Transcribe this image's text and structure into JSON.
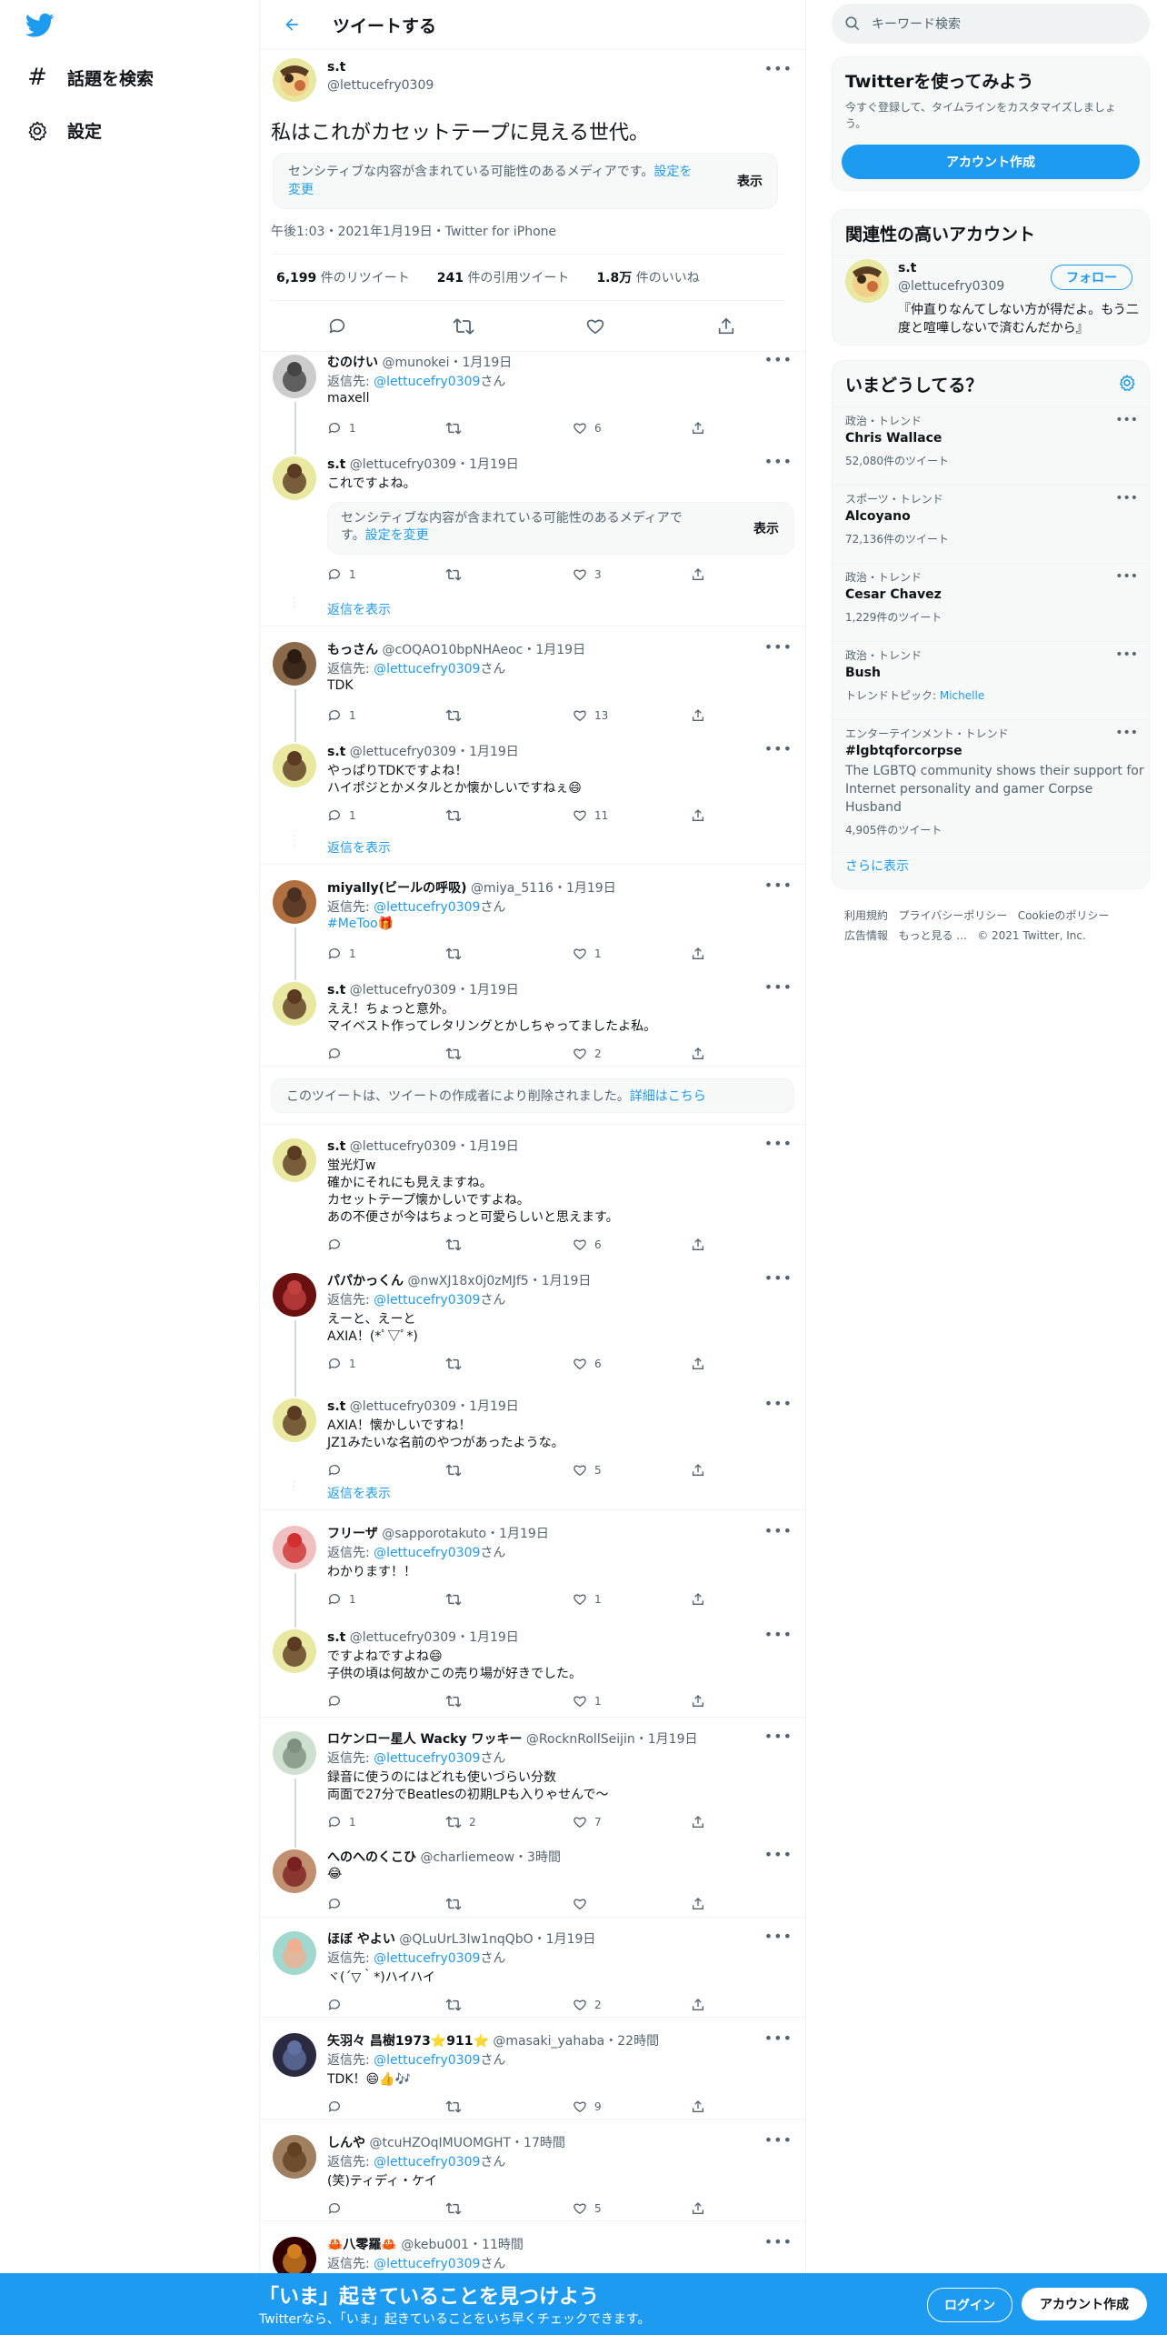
{
  "colors": {
    "accent": "#1d9bf0",
    "muted": "#536471",
    "banner": "#1d9bf0"
  },
  "nav": {
    "explore": "話題を検索",
    "settings": "設定"
  },
  "header": {
    "title": "ツイートする"
  },
  "main_tweet": {
    "name": "s.t",
    "handle": "@lettucefry0309",
    "text": "私はこれがカセットテープに見える世代。",
    "sensitive_1": "センシティブな内容が含まれている可能性のあるメディアです。",
    "sensitive_link_1": "設定を",
    "sensitive_link_2": "変更",
    "show": "表示",
    "meta": "午後1:03・2021年1月19日・Twitter for iPhone",
    "retweets_num": "6,199",
    "retweets_label": "件のリツイート",
    "quotes_num": "241",
    "quotes_label": "件の引用ツイート",
    "likes_num": "1.8万",
    "likes_label": "件のいいね"
  },
  "common": {
    "reply_to": "返信先:",
    "san": "さん",
    "reply_handle": "@lettucefry0309",
    "show_replies": "返信を表示",
    "sep": "・"
  },
  "replies": [
    {
      "name": "むのけい",
      "handle": "@munokei",
      "time": "1月19日",
      "reply_to": true,
      "lines": [
        "maxell"
      ],
      "r": "1",
      "rt": "",
      "l": "6"
    },
    {
      "name": "s.t",
      "handle": "@lettucefry0309",
      "time": "1月19日",
      "reply_to": false,
      "lines": [
        "これですよね。"
      ],
      "sens_1": "センシティブな内容が含まれている可能性のあるメディアで",
      "sens_2": "す。",
      "sens_link": "設定を変更",
      "r": "1",
      "rt": "",
      "l": "3"
    },
    {
      "name": "もっさん",
      "handle": "@cOQAO10bpNHAeoc",
      "time": "1月19日",
      "reply_to": true,
      "lines": [
        "TDK"
      ],
      "r": "1",
      "rt": "",
      "l": "13"
    },
    {
      "name": "s.t",
      "handle": "@lettucefry0309",
      "time": "1月19日",
      "reply_to": false,
      "lines": [
        "やっぱりTDKですよね！",
        "ハイポジとかメタルとか懐かしいですねぇ😄"
      ],
      "r": "1",
      "rt": "",
      "l": "11"
    },
    {
      "name": "miyally(ビールの呼吸)",
      "handle": "@miya_5116",
      "time": "1月19日",
      "reply_to": true,
      "lines": [
        "#MeToo🎁"
      ],
      "r": "1",
      "rt": "",
      "l": "1"
    },
    {
      "name": "s.t",
      "handle": "@lettucefry0309",
      "time": "1月19日",
      "reply_to": false,
      "lines": [
        "ええ！ちょっと意外。",
        "マイベスト作ってレタリングとかしちゃってましたよ私。"
      ],
      "r": "",
      "rt": "",
      "l": "2"
    },
    {
      "name": "s.t",
      "handle": "@lettucefry0309",
      "time": "1月19日",
      "reply_to": false,
      "lines": [
        "蛍光灯w",
        "確かにそれにも見えますね。",
        "カセットテープ懐かしいですよね。",
        "あの不便さが今はちょっと可愛らしいと思えます。"
      ],
      "r": "",
      "rt": "",
      "l": "6"
    },
    {
      "name": "パパかっくん",
      "handle": "@nwXJ18x0j0zMJf5",
      "time": "1月19日",
      "reply_to": true,
      "lines": [
        "えーと、えーと",
        "AXIA！(*ﾟ▽ﾟ*)"
      ],
      "r": "1",
      "rt": "",
      "l": "6"
    },
    {
      "name": "s.t",
      "handle": "@lettucefry0309",
      "time": "1月19日",
      "reply_to": false,
      "lines": [
        "AXIA！懐かしいですね！",
        "JZ1みたいな名前のやつがあったような。"
      ],
      "r": "",
      "rt": "",
      "l": "5"
    },
    {
      "name": "フリーザ",
      "handle": "@sapporotakuto",
      "time": "1月19日",
      "reply_to": true,
      "lines": [
        "わかります！！"
      ],
      "r": "1",
      "rt": "",
      "l": "1"
    },
    {
      "name": "s.t",
      "handle": "@lettucefry0309",
      "time": "1月19日",
      "reply_to": false,
      "lines": [
        "ですよねですよね😄",
        "子供の頃は何故かこの売り場が好きでした。"
      ],
      "r": "",
      "rt": "",
      "l": "1"
    },
    {
      "name": "ロケンロー星人 Wacky ワッキー",
      "handle": "@RocknRollSeijin",
      "time": "1月19日",
      "reply_to": true,
      "lines": [
        "録音に使うのにはどれも使いづらい分数",
        "両面で27分でBeatlesの初期LPも入りゃせんで〜"
      ],
      "r": "1",
      "rt": "2",
      "l": "7"
    },
    {
      "name": "へのへのくこひ",
      "handle": "@charliemeow",
      "time": "3時間",
      "reply_to": false,
      "lines": [
        "😂"
      ],
      "r": "",
      "rt": "",
      "l": ""
    },
    {
      "name": "ほぼ やよい",
      "handle": "@QLuUrL3Iw1nqQbO",
      "time": "1月19日",
      "reply_to": true,
      "lines": [
        "ヾ(´▽｀*)ハイハイ"
      ],
      "r": "",
      "rt": "",
      "l": "2"
    },
    {
      "name": "矢羽々 昌樹1973⭐911⭐",
      "handle": "@masaki_yahaba",
      "time": "22時間",
      "reply_to": true,
      "lines": [
        "TDK！😄👍🎶"
      ],
      "r": "",
      "rt": "",
      "l": "9"
    },
    {
      "name": "しんや",
      "handle": "@tcuHZOqIMUOMGHT",
      "time": "17時間",
      "reply_to": true,
      "lines": [
        "(笑)ティディ・ケイ"
      ],
      "r": "",
      "rt": "",
      "l": "5"
    },
    {
      "name": "🦀八零羅🦀",
      "handle": "@kebu001",
      "time": "11時間",
      "reply_to": true,
      "lines": [],
      "r": "",
      "rt": "",
      "l": ""
    }
  ],
  "deleted": {
    "text": "このツイートは、ツイートの作成者により削除されました。",
    "link": "詳細はこちら"
  },
  "search": {
    "placeholder": "キーワード検索"
  },
  "signup": {
    "title": "Twitterを使ってみよう",
    "desc": "今すぐ登録して、タイムラインをカスタマイズしましょう。",
    "button": "アカウント作成"
  },
  "related": {
    "title": "関連性の高いアカウント",
    "name": "s.t",
    "handle": "@lettucefry0309",
    "follow": "フォロー",
    "bio": "『仲直りなんてしない方が得だよ。もう二度と喧嘩しないで済むんだから』"
  },
  "trends": {
    "title": "いまどうしてる？",
    "items": [
      {
        "category": "政治・トレンド",
        "name": "Chris Wallace",
        "count": "52,080件のツイート"
      },
      {
        "category": "スポーツ・トレンド",
        "name": "Alcoyano",
        "count": "72,136件のツイート"
      },
      {
        "category": "政治・トレンド",
        "name": "Cesar Chavez",
        "count": "1,229件のツイート"
      },
      {
        "category": "政治・トレンド",
        "name": "Bush",
        "topic_label": "トレンドトピック: ",
        "topic": "Michelle"
      },
      {
        "category": "エンターテインメント・トレンド",
        "name": "#lgbtqforcorpse",
        "desc": [
          "The LGBTQ community shows their support for",
          "Internet personality and gamer Corpse",
          "Husband"
        ],
        "count": "4,905件のツイート"
      }
    ],
    "more": "さらに表示"
  },
  "footer": {
    "line1": [
      "利用規約",
      "プライバシーポリシー",
      "Cookieのポリシー"
    ],
    "line2": [
      "広告情報",
      "もっと見る ...",
      "© 2021 Twitter, Inc."
    ]
  },
  "banner": {
    "title": "「いま」起きていることを見つけよう",
    "subtitle": "Twitterなら、「いま」起きていることをいち早くチェックできます。",
    "login": "ログイン",
    "signup": "アカウント作成"
  }
}
